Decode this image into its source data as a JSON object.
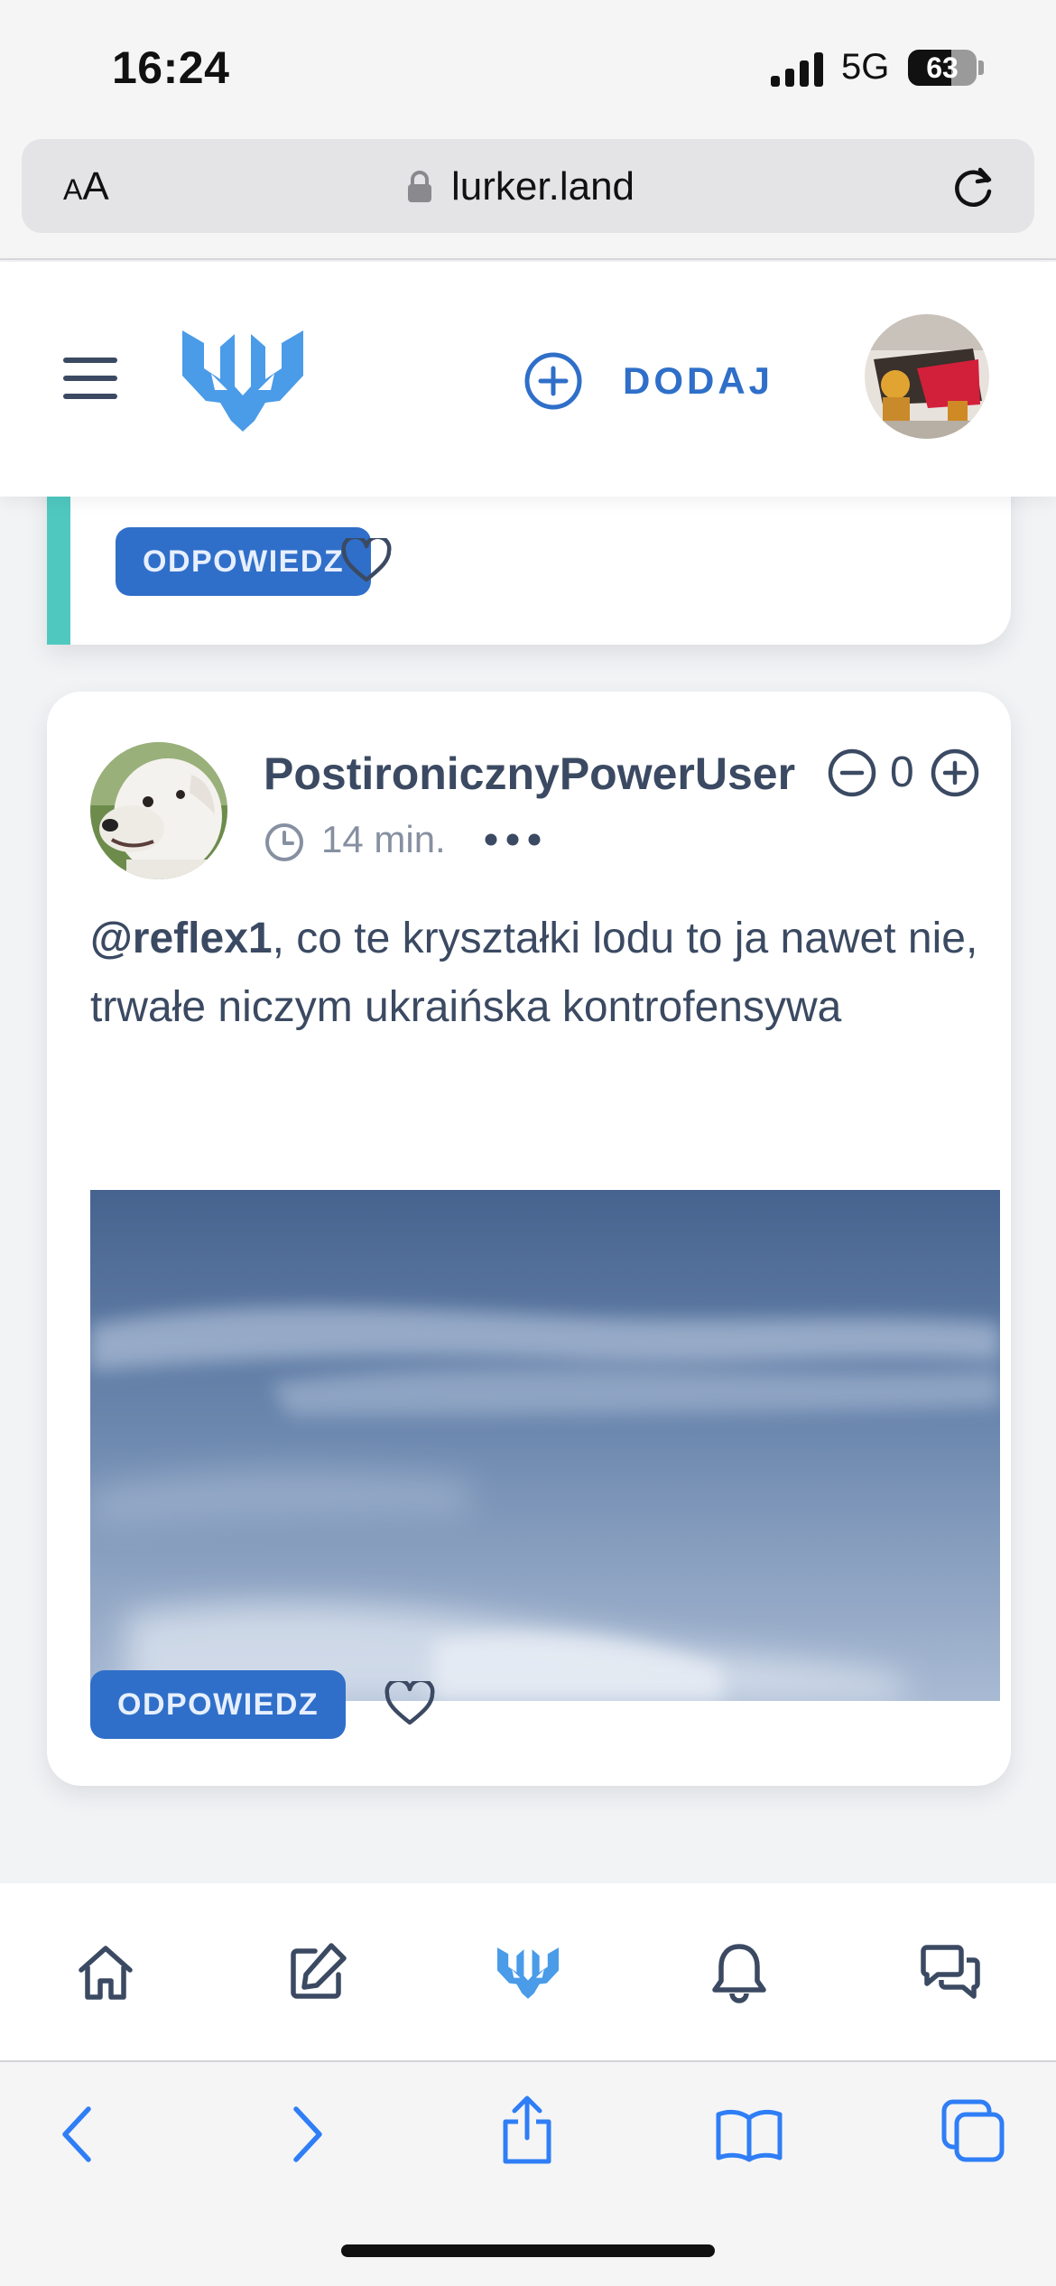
{
  "status_bar": {
    "time": "16:24",
    "network": "5G",
    "battery": "63",
    "battery_level_percent": 63
  },
  "browser": {
    "text_size_small": "A",
    "text_size_large": "A",
    "url": "lurker.land"
  },
  "header": {
    "add_label": "DODAJ"
  },
  "previous_comment": {
    "reply_label": "ODPOWIEDZ",
    "accent_color": "#4fc9c0"
  },
  "comment": {
    "username": "PostironicznyPowerUser",
    "vote_count": "0",
    "time_ago": "14 min.",
    "mention": "@reflex1",
    "text": ", co te kryształki lodu to ja nawet nie, trwałe niczym ukraińska kontrofensywa",
    "reply_label": "ODPOWIEDZ"
  },
  "bottom_nav": {
    "items": [
      "home-icon",
      "edit-icon",
      "logo-icon",
      "bell-icon",
      "chat-icon"
    ]
  },
  "safari_toolbar": {
    "items": [
      "back-icon",
      "forward-icon",
      "share-icon",
      "bookmarks-icon",
      "tabs-icon"
    ]
  },
  "colors": {
    "accent_blue": "#2f6fc9",
    "logo_blue": "#4a9be8",
    "text_dark": "#3b4a62",
    "text_muted": "#8690a1",
    "safari_blue": "#2f7ef6"
  }
}
